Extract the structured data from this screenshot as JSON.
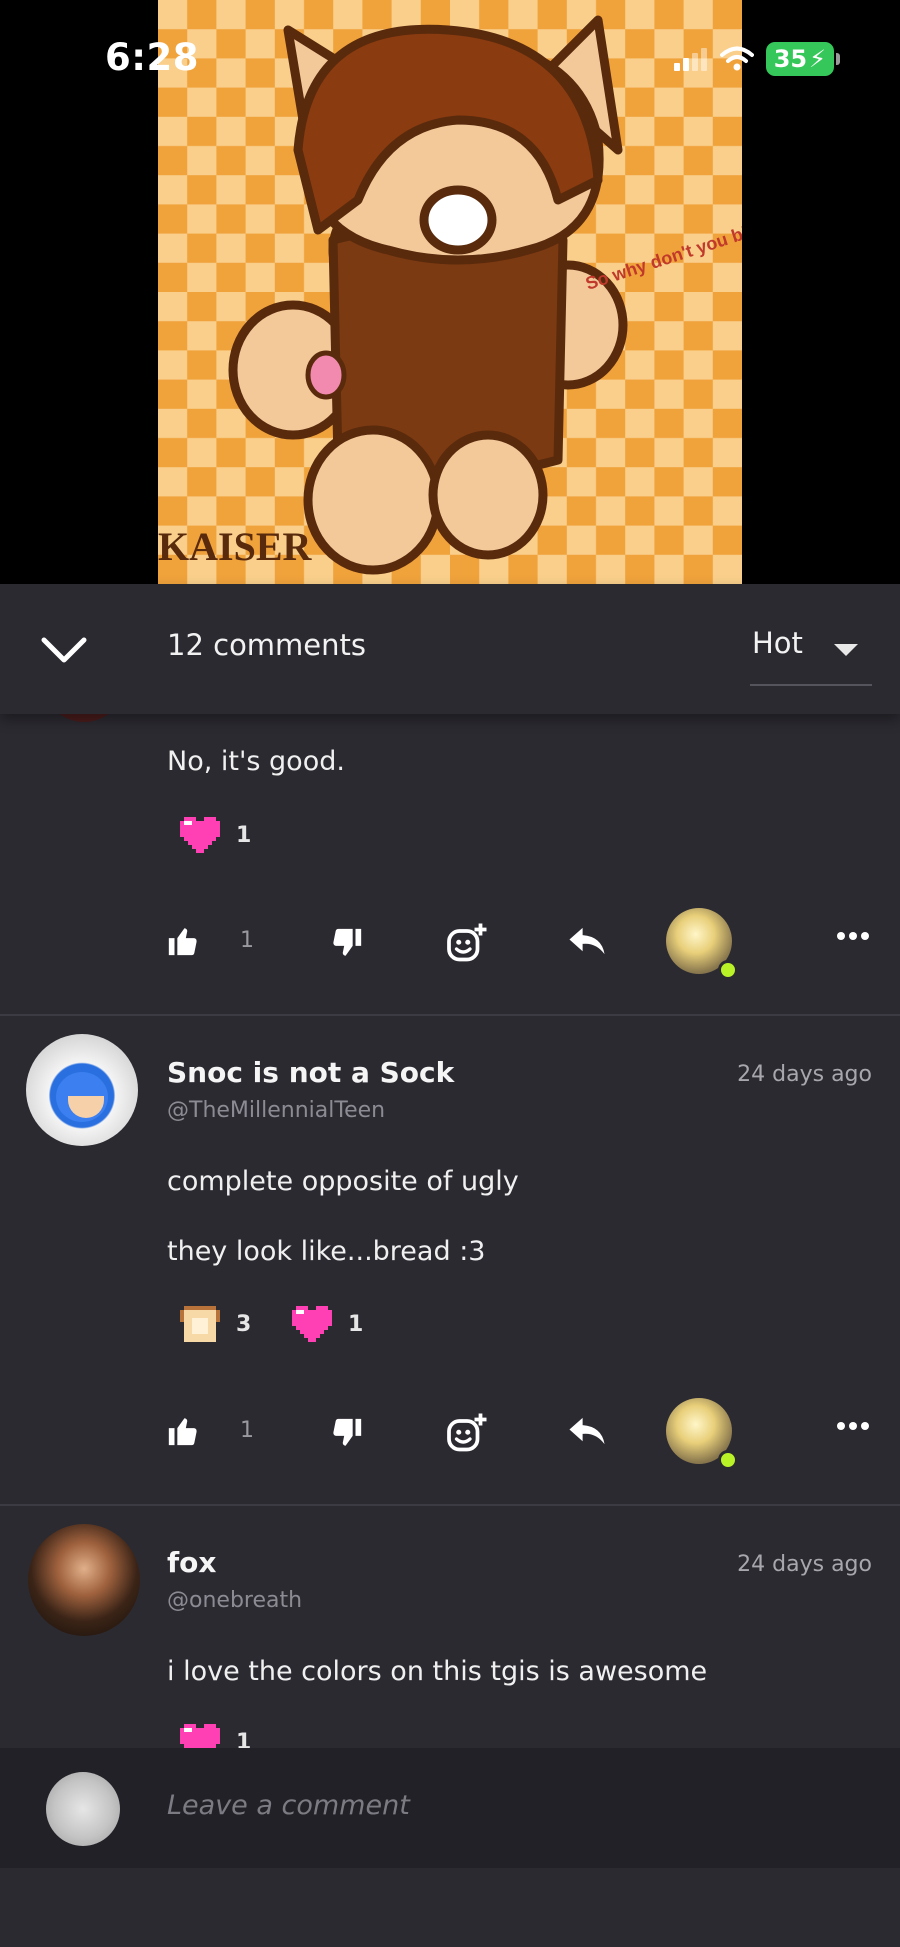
{
  "status_bar": {
    "time": "6:28",
    "battery": "35"
  },
  "artwork_text": {
    "caption": "So why don't you blow me",
    "signature": "KAISER"
  },
  "header": {
    "comments_count": "12 comments",
    "sort": "Hot"
  },
  "comments": [
    {
      "text": "No, it's good.",
      "reactions": [
        {
          "icon": "heart-icon",
          "count": "1"
        }
      ],
      "likes": "1"
    },
    {
      "author": "Snoc is not a Sock",
      "handle": "@TheMillennialTeen",
      "time": "24 days ago",
      "text_line1": "complete opposite of ugly",
      "text_line2": "they look like...bread :3",
      "reactions": [
        {
          "icon": "bread-icon",
          "count": "3"
        },
        {
          "icon": "heart-icon",
          "count": "1"
        }
      ],
      "likes": "1"
    },
    {
      "author": "fox",
      "handle": "@onebreath",
      "time": "24 days ago",
      "text": "i love the colors on this tgis is awesome",
      "reactions": [
        {
          "icon": "heart-icon",
          "count": "1"
        }
      ]
    }
  ],
  "composer": {
    "placeholder": "Leave a comment"
  },
  "colors": {
    "background": "#2b2a31",
    "composer": "#222127",
    "heart": "#ff3fb4",
    "online": "#b9f227",
    "battery": "#35c759",
    "art_orange": "#f2a33a"
  }
}
